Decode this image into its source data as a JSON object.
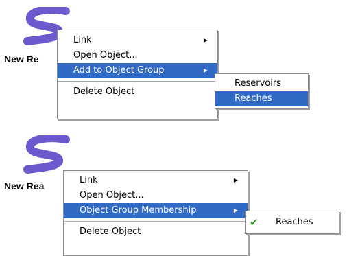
{
  "scene1": {
    "object_label": "New Re",
    "context_menu": {
      "items": [
        {
          "label": "Link",
          "has_submenu": true
        },
        {
          "label": "Open Object..."
        },
        {
          "label": "Add to Object Group",
          "has_submenu": true,
          "selected": true
        },
        {
          "label": "Delete Object"
        }
      ]
    },
    "submenu": {
      "items": [
        {
          "label": "Reservoirs"
        },
        {
          "label": "Reaches",
          "selected": true
        }
      ]
    }
  },
  "scene2": {
    "object_label": "New Rea",
    "context_menu": {
      "items": [
        {
          "label": "Link",
          "has_submenu": true
        },
        {
          "label": "Open Object..."
        },
        {
          "label": "Object Group Membership",
          "has_submenu": true,
          "selected": true
        },
        {
          "label": "Delete Object"
        }
      ]
    },
    "submenu": {
      "items": [
        {
          "label": "Reaches",
          "checked": true,
          "check_icon": "check-icon"
        }
      ]
    }
  },
  "colors": {
    "selection": "#316ac5",
    "reach_icon": "#6a5acd",
    "check": "#2a9d1f"
  }
}
